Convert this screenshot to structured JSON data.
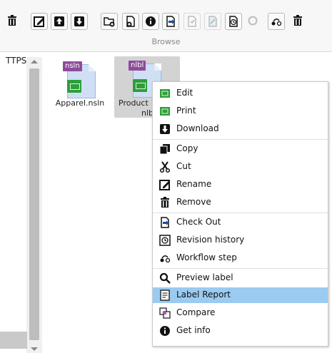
{
  "toolbar": {
    "section_label": "Browse",
    "buttons": [
      {
        "name": "remove",
        "icon": "trash-icon"
      },
      {
        "name": "edit",
        "icon": "edit-icon"
      },
      {
        "name": "upload",
        "icon": "upload-icon"
      },
      {
        "name": "download",
        "icon": "download-icon"
      },
      {
        "name": "new-folder",
        "icon": "new-folder-icon"
      },
      {
        "name": "add-file",
        "icon": "add-file-icon"
      },
      {
        "name": "info",
        "icon": "info-icon"
      },
      {
        "name": "checkout",
        "icon": "checkout-icon"
      },
      {
        "name": "checkin",
        "icon": "checkin-icon"
      },
      {
        "name": "undo-checkout",
        "icon": "undo-checkout-icon"
      },
      {
        "name": "revision-history",
        "icon": "history-icon"
      },
      {
        "name": "refresh",
        "icon": "refresh-icon"
      },
      {
        "name": "workflow",
        "icon": "workflow-icon"
      },
      {
        "name": "delete",
        "icon": "trash-icon"
      }
    ]
  },
  "left_pane": {
    "text": "TTPS"
  },
  "files": [
    {
      "tag": "nsln",
      "name": "Apparel.nsln"
    },
    {
      "tag": "nlbl",
      "name_line1": "Product",
      "name_line2": "nlb"
    }
  ],
  "context_menu": {
    "items": [
      {
        "label": "Edit",
        "icon": "label-edit-icon"
      },
      {
        "label": "Print",
        "icon": "label-print-icon"
      },
      {
        "label": "Download",
        "icon": "download-icon"
      },
      {
        "label": "Copy",
        "icon": "copy-icon"
      },
      {
        "label": "Cut",
        "icon": "scissors-icon"
      },
      {
        "label": "Rename",
        "icon": "rename-icon"
      },
      {
        "label": "Remove",
        "icon": "trash-icon"
      },
      {
        "label": "Check Out",
        "icon": "checkout-icon"
      },
      {
        "label": "Revision history",
        "icon": "history-icon"
      },
      {
        "label": "Workflow step",
        "icon": "workflow-icon"
      },
      {
        "label": "Preview label",
        "icon": "search-icon"
      },
      {
        "label": "Label Report",
        "icon": "report-icon"
      },
      {
        "label": "Compare",
        "icon": "compare-icon"
      },
      {
        "label": "Get info",
        "icon": "info-icon"
      }
    ],
    "highlighted": "Label Report"
  },
  "colors": {
    "highlight": "#9ccbf1",
    "tag_purple": "#8e4b9b",
    "label_green": "#2e9e3a"
  }
}
